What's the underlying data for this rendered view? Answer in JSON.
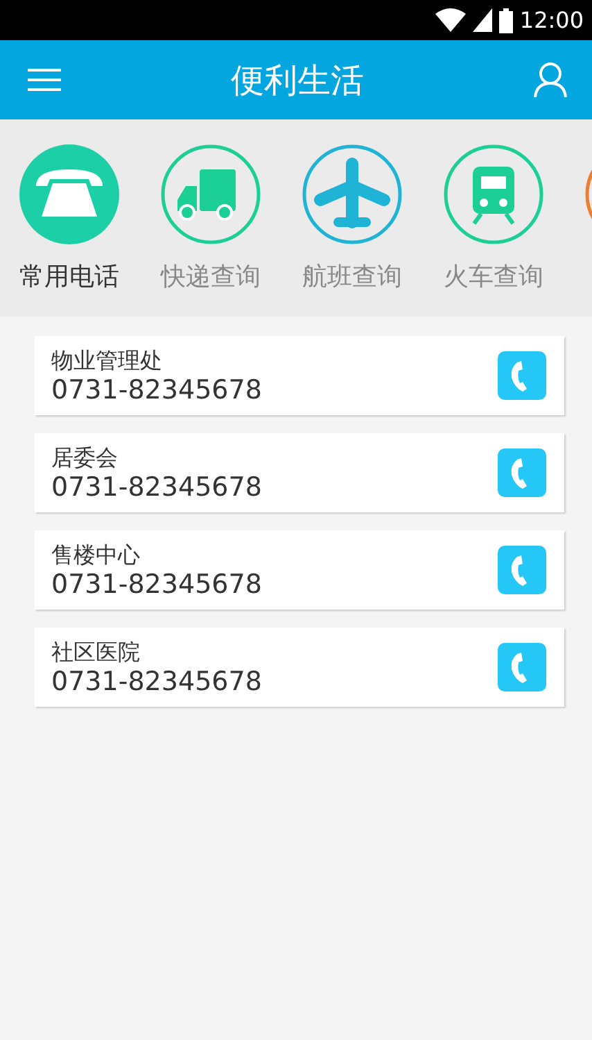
{
  "status_bar": {
    "time": "12:00"
  },
  "app_bar": {
    "title": "便利生活"
  },
  "categories": [
    {
      "kind": "phone",
      "label": "常用电话",
      "selected": true,
      "color": "#1ccfa6"
    },
    {
      "kind": "truck",
      "label": "快递查询",
      "selected": false,
      "color": "#1ccf94"
    },
    {
      "kind": "plane",
      "label": "航班查询",
      "selected": false,
      "color": "#1fb3d6"
    },
    {
      "kind": "train",
      "label": "火车查询",
      "selected": false,
      "color": "#1ccf94"
    },
    {
      "kind": "other",
      "selected": false,
      "color": "#ef7d2d"
    }
  ],
  "contacts": [
    {
      "name": "物业管理处",
      "phone": "0731-82345678"
    },
    {
      "name": "居委会",
      "phone": "0731-82345678"
    },
    {
      "name": "售楼中心",
      "phone": "0731-82345678"
    },
    {
      "name": "社区医院",
      "phone": "0731-82345678"
    }
  ]
}
